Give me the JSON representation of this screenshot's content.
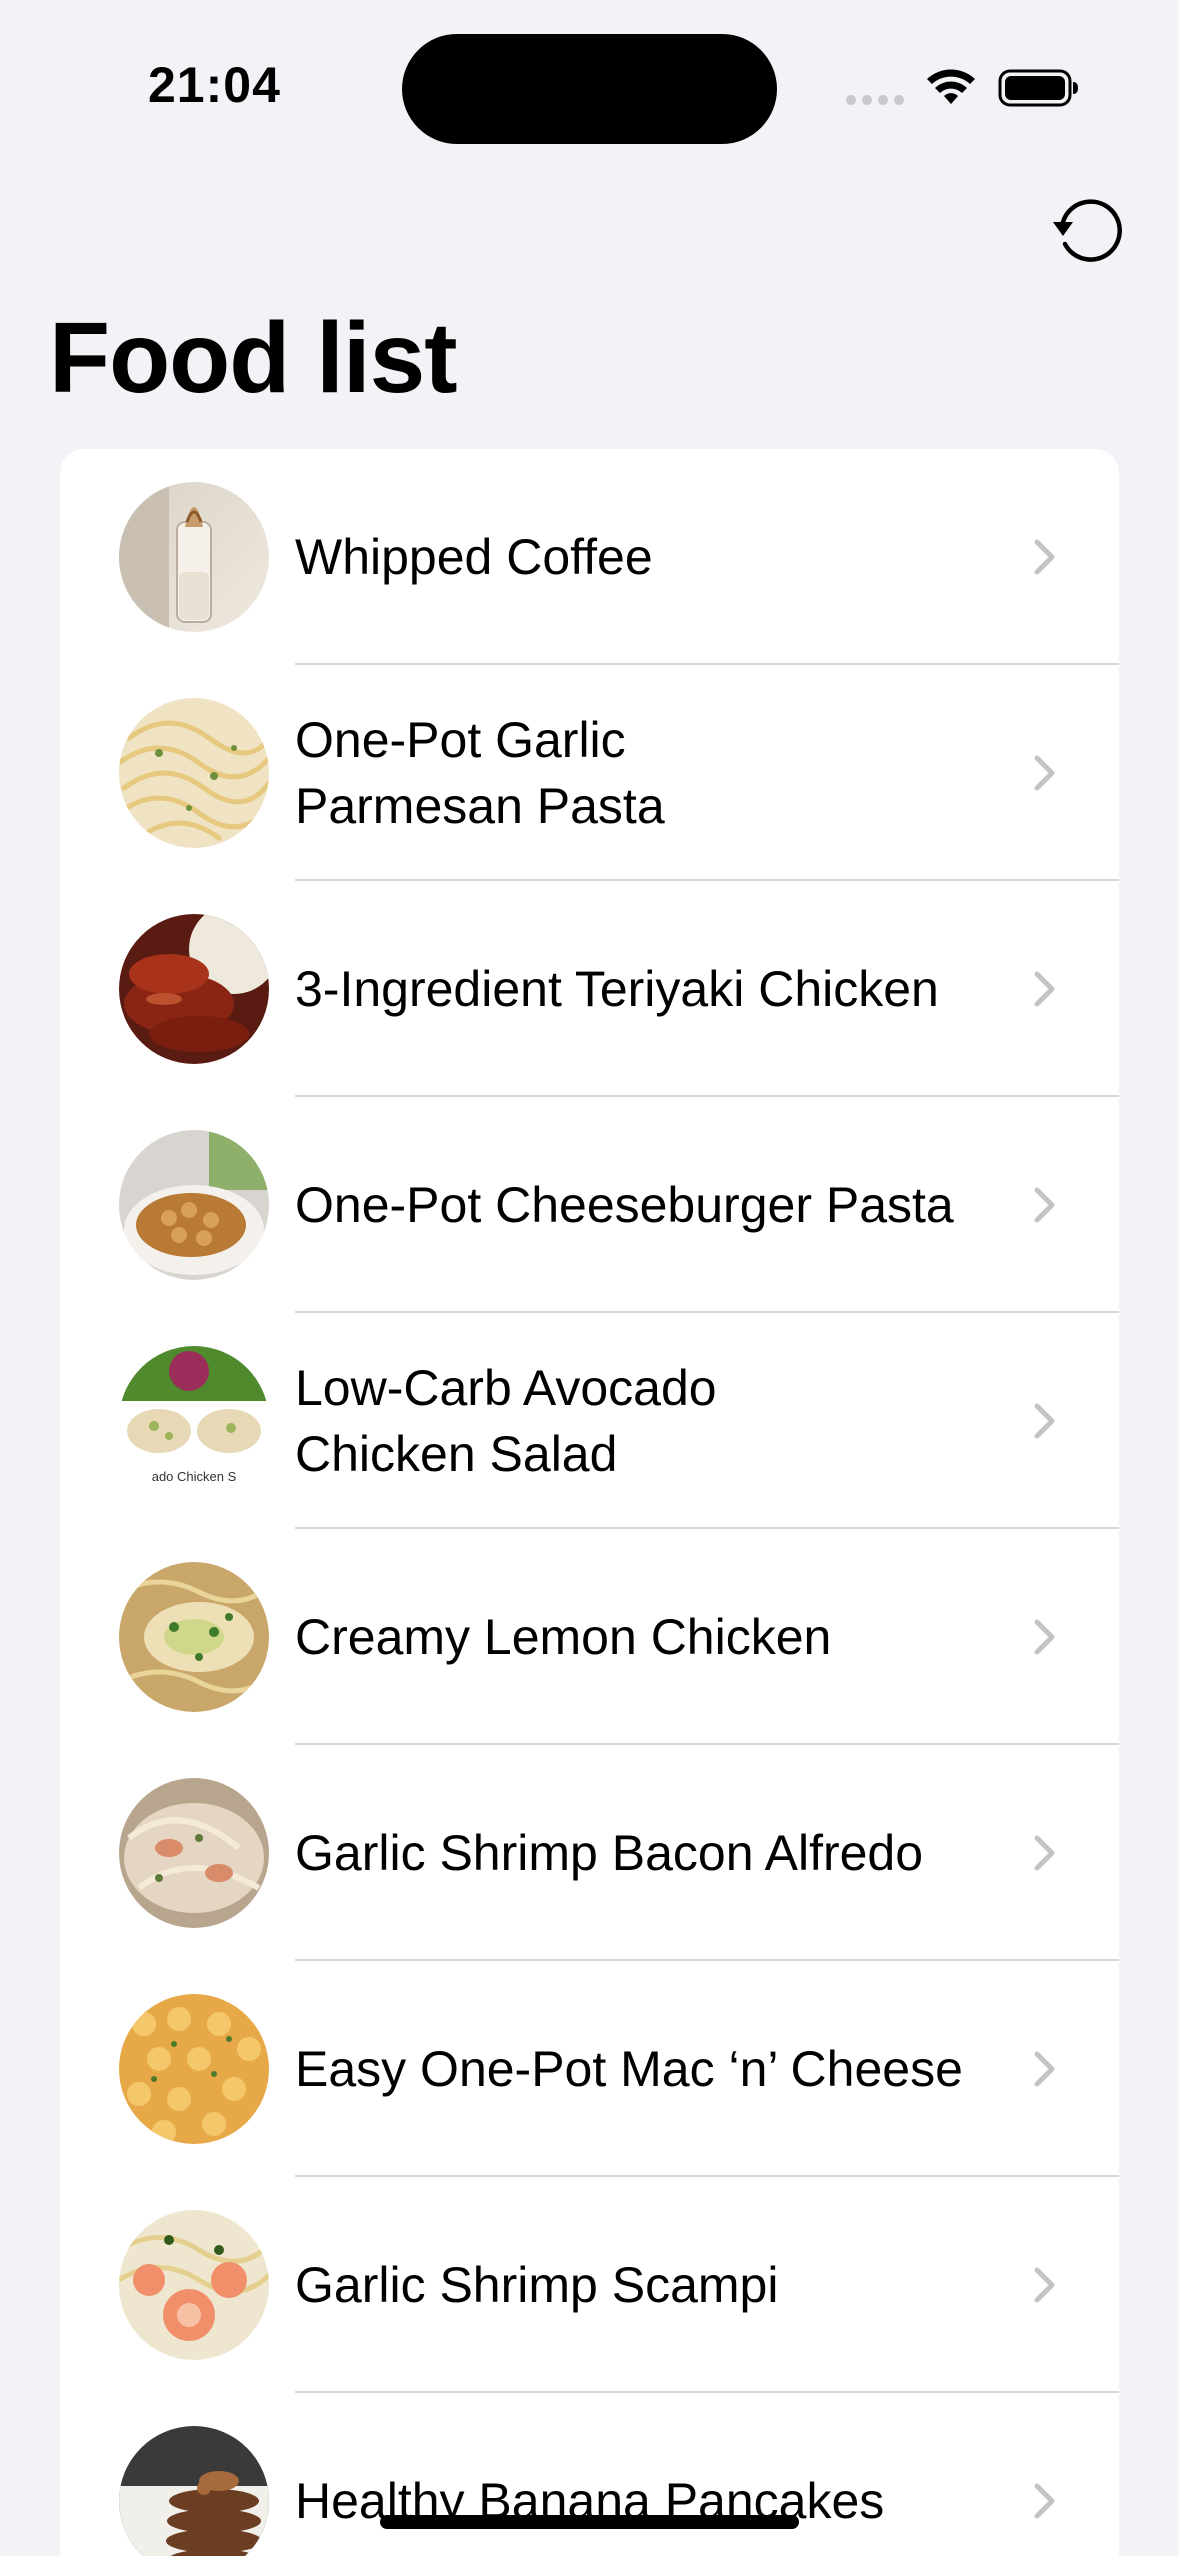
{
  "status_bar": {
    "time": "21:04"
  },
  "header": {
    "title": "Food list",
    "refresh_icon": "arrow-counterclockwise-icon"
  },
  "colors": {
    "background": "#f2f2f7",
    "card": "#ffffff",
    "chevron": "#c4c4c7",
    "divider": "#d8d8dc"
  },
  "food_list": {
    "items": [
      {
        "lines": [
          "Whipped Coffee"
        ],
        "thumb": "whipped-coffee-image"
      },
      {
        "lines": [
          "One-Pot Garlic",
          "Parmesan Pasta"
        ],
        "thumb": "garlic-parmesan-pasta-image"
      },
      {
        "lines": [
          "3-Ingredient Teriyaki Chicken"
        ],
        "thumb": "teriyaki-chicken-image"
      },
      {
        "lines": [
          "One-Pot Cheeseburger Pasta"
        ],
        "thumb": "cheeseburger-pasta-image"
      },
      {
        "lines": [
          "Low-Carb Avocado",
          "Chicken Salad"
        ],
        "thumb": "avocado-chicken-salad-image"
      },
      {
        "lines": [
          "Creamy Lemon Chicken"
        ],
        "thumb": "creamy-lemon-chicken-image"
      },
      {
        "lines": [
          "Garlic Shrimp Bacon Alfredo"
        ],
        "thumb": "shrimp-bacon-alfredo-image"
      },
      {
        "lines": [
          "Easy One-Pot Mac ‘n’ Cheese"
        ],
        "thumb": "mac-n-cheese-image"
      },
      {
        "lines": [
          "Garlic Shrimp Scampi"
        ],
        "thumb": "shrimp-scampi-image"
      },
      {
        "lines": [
          "Healthy Banana Pancakes"
        ],
        "thumb": "banana-pancakes-image"
      }
    ],
    "thumb_caption": "ado Chicken S"
  }
}
